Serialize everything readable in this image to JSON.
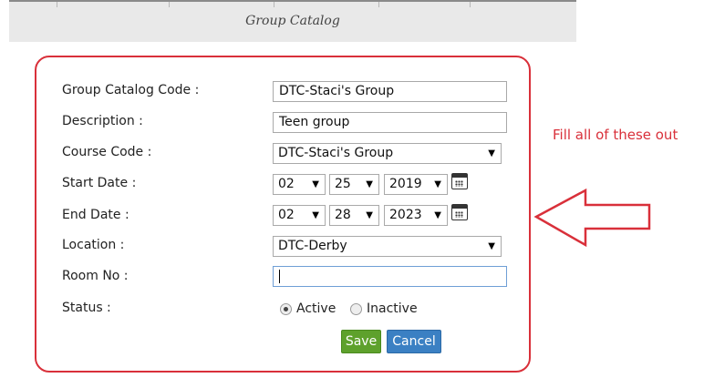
{
  "header": {
    "title": "Group Catalog"
  },
  "form": {
    "group_catalog_code": {
      "label": "Group Catalog Code :",
      "value": "DTC-Staci's Group"
    },
    "description": {
      "label": "Description :",
      "value": "Teen group"
    },
    "course_code": {
      "label": "Course Code :",
      "value": "DTC-Staci's Group"
    },
    "start_date": {
      "label": "Start Date :",
      "month": "02",
      "day": "25",
      "year": "2019"
    },
    "end_date": {
      "label": "End Date :",
      "month": "02",
      "day": "28",
      "year": "2023"
    },
    "location": {
      "label": "Location :",
      "value": "DTC-Derby"
    },
    "room_no": {
      "label": "Room No :",
      "value": ""
    },
    "status": {
      "label": "Status :",
      "options": [
        "Active",
        "Inactive"
      ],
      "selected": "Active"
    },
    "save_label": "Save",
    "cancel_label": "Cancel"
  },
  "annotation": {
    "note": "Fill all of these out",
    "color": "#d9303a"
  },
  "icons": {
    "calendar": "calendar-icon",
    "dropdown": "chevron-down-icon",
    "arrow": "left-arrow-outline"
  }
}
